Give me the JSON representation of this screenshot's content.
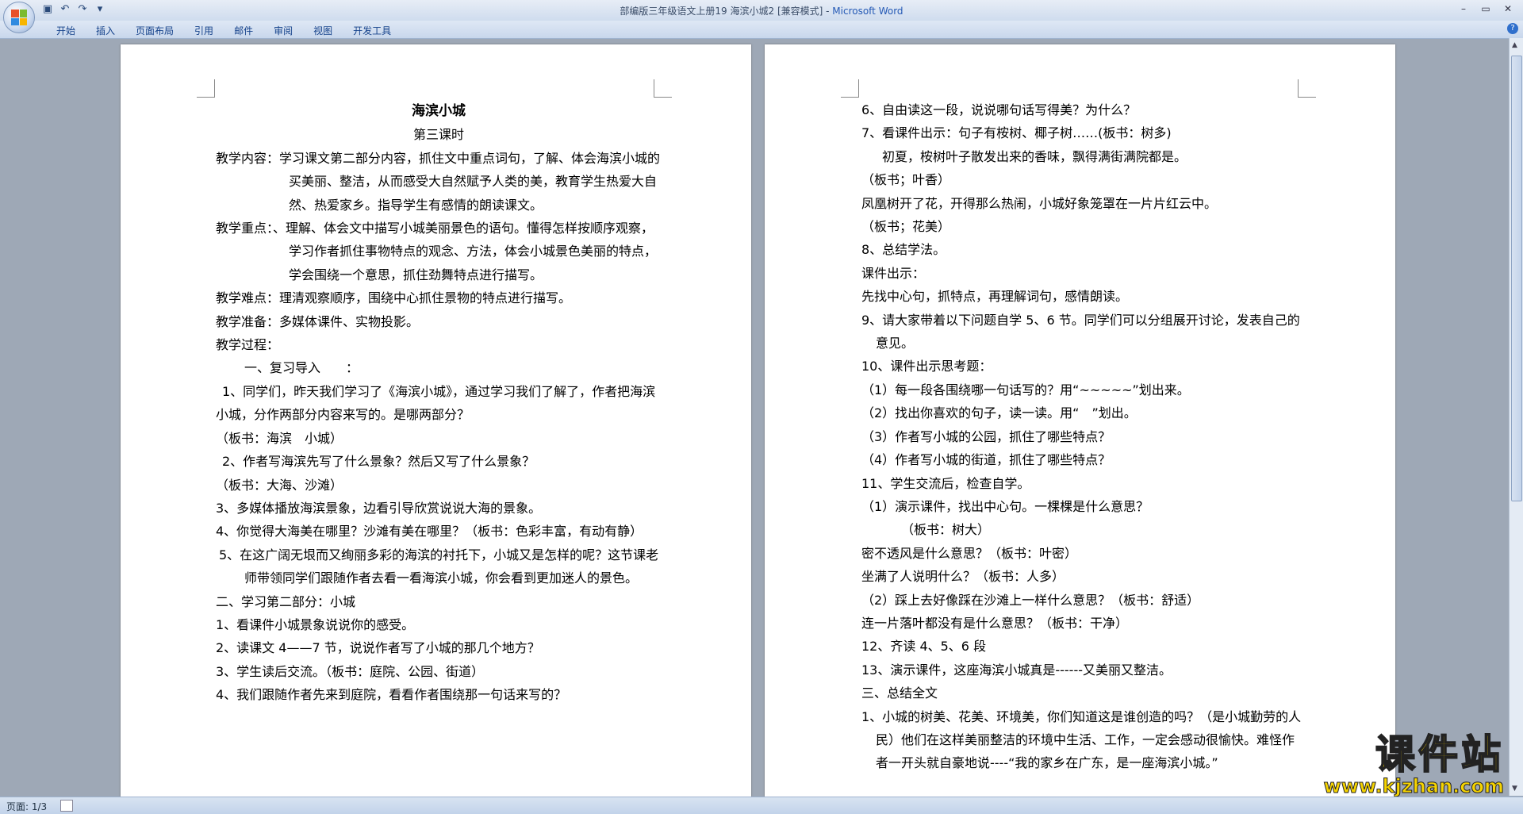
{
  "window": {
    "title": "部编版三年级语文上册19 海滨小城2 [兼容模式] - ",
    "app_name": "Microsoft Word"
  },
  "ribbon": {
    "tabs": [
      "开始",
      "插入",
      "页面布局",
      "引用",
      "邮件",
      "审阅",
      "视图",
      "开发工具"
    ]
  },
  "statusbar": {
    "page_info": "页面: 1/3"
  },
  "page1": {
    "title": "海滨小城",
    "subtitle": "第三课时",
    "lines": [
      "教学内容：学习课文第二部分内容，抓住文中重点词句，了解、体会海滨小城的买美丽、整洁，从而感受大自然赋予人类的美，教育学生热爱大自然、热爱家乡。指导学生有感情的朗读课文。",
      "教学重点：、理解、体会文中描写小城美丽景色的语句。懂得怎样按顺序观察，学习作者抓住事物特点的观念、方法，体会小城景色美丽的特点，学会围绕一个意思，抓住劲舞特点进行描写。",
      "教学难点：理清观察顺序，围绕中心抓住景物的特点进行描写。",
      "教学准备：多媒体课件、实物投影。",
      "教学过程：",
      "一、复习导入　　：",
      "1、同学们，昨天我们学习了《海滨小城》，通过学习我们了解了，作者把海滨小城，分作两部分内容来写的。是哪两部分？",
      "（板书：海滨　小城）",
      "2、作者写海滨先写了什么景象？然后又写了什么景象？",
      "（板书：大海、沙滩）",
      "3、多媒体播放海滨景象，边看引导欣赏说说大海的景象。",
      "4、你觉得大海美在哪里？沙滩有美在哪里？（板书：色彩丰富，有动有静）",
      "5、在这广阔无垠而又绚丽多彩的海滨的衬托下，小城又是怎样的呢？这节课老师带领同学们跟随作者去看一看海滨小城，你会看到更加迷人的景色。",
      "二、学习第二部分：小城",
      "1、看课件小城景象说说你的感受。",
      "2、读课文 4——7 节，说说作者写了小城的那几个地方？",
      "3、学生读后交流。（板书：庭院、公园、街道）",
      "4、我们跟随作者先来到庭院，看看作者围绕那一句话来写的？"
    ]
  },
  "page2": {
    "lines": [
      "6、自由读这一段，说说哪句话写得美？为什么？",
      "7、看课件出示：句子有桉树、椰子树……(板书：树多)",
      "初夏，桉树叶子散发出来的香味，飘得满街满院都是。",
      "（板书；叶香）",
      "凤凰树开了花，开得那么热闹，小城好象笼罩在一片片红云中。",
      "（板书；花美）",
      "8、总结学法。",
      "课件出示：",
      "先找中心句，抓特点，再理解词句，感情朗读。",
      "9、请大家带着以下问题自学 5、6 节。同学们可以分组展开讨论，发表自己的意见。",
      "10、课件出示思考题：",
      "（1）每一段各围绕哪一句话写的？用“~~~~~”划出来。",
      "（2）找出你喜欢的句子，读一读。用“　”划出。",
      "（3）作者写小城的公园，抓住了哪些特点？",
      "（4）作者写小城的街道，抓住了哪些特点？",
      "11、学生交流后，检查自学。",
      "（1）演示课件，找出中心句。一棵棵是什么意思？",
      "（板书：树大）",
      "密不透风是什么意思？（板书：叶密）",
      "坐满了人说明什么？（板书：人多）",
      "（2）踩上去好像踩在沙滩上一样什么意思？（板书：舒适）",
      "连一片落叶都没有是什么意思？（板书：干净）",
      "12、齐读 4、5、6 段",
      "13、演示课件，这座海滨小城真是------又美丽又整洁。",
      "三、总结全文",
      "1、小城的树美、花美、环境美，你们知道这是谁创造的吗？（是小城勤劳的人民）他们在这样美丽整洁的环境中生活、工作，一定会感动很愉快。难怪作者一开头就自豪地说----“我的家乡在广东，是一座海滨小城。”"
    ]
  },
  "watermark": {
    "brand": "课件站",
    "url": "www.kjzhan.com"
  }
}
